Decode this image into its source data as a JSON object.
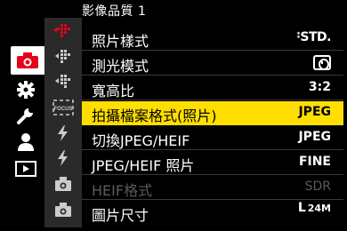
{
  "menu": {
    "title": "影像品質 1"
  },
  "main_tabs": [
    {
      "icon": "camera-icon",
      "active": true
    },
    {
      "icon": "gear-icon",
      "active": false
    },
    {
      "icon": "wrench-icon",
      "active": false
    },
    {
      "icon": "person-icon",
      "active": false
    },
    {
      "icon": "playback-icon",
      "active": false
    }
  ],
  "sub_tabs": [
    {
      "icon": "image-quality-icon-1"
    },
    {
      "icon": "image-quality-icon-2"
    },
    {
      "icon": "image-quality-icon-3"
    },
    {
      "icon": "focus-icon",
      "text": "FOCUS"
    },
    {
      "icon": "flash-icon-1"
    },
    {
      "icon": "flash-icon-2"
    },
    {
      "icon": "camera-small-icon-1"
    },
    {
      "icon": "camera-small-icon-2"
    }
  ],
  "items": [
    {
      "label": "照片樣式",
      "value": "STD.",
      "value_prefix": "⁑",
      "state": "normal"
    },
    {
      "label": "測光模式",
      "value": "",
      "value_icon": "metering-icon",
      "state": "normal"
    },
    {
      "label": "寬高比",
      "value": "3:2",
      "state": "normal"
    },
    {
      "label": "拍攝檔案格式(照片)",
      "value": "JPEG",
      "state": "selected"
    },
    {
      "label": "切換JPEG/HEIF",
      "value": "JPEG",
      "state": "normal"
    },
    {
      "label": "JPEG/HEIF 照片",
      "value": "FINE",
      "state": "normal"
    },
    {
      "label": "HEIF格式",
      "value": "SDR",
      "state": "disabled"
    },
    {
      "label": "圖片尺寸",
      "value": "L",
      "value_suffix": "24M",
      "state": "normal"
    }
  ],
  "colors": {
    "selected_bg": "#ffde00",
    "active_tab_icon": "#e8001c",
    "sub_tab_bg": "#2a2a2a"
  }
}
